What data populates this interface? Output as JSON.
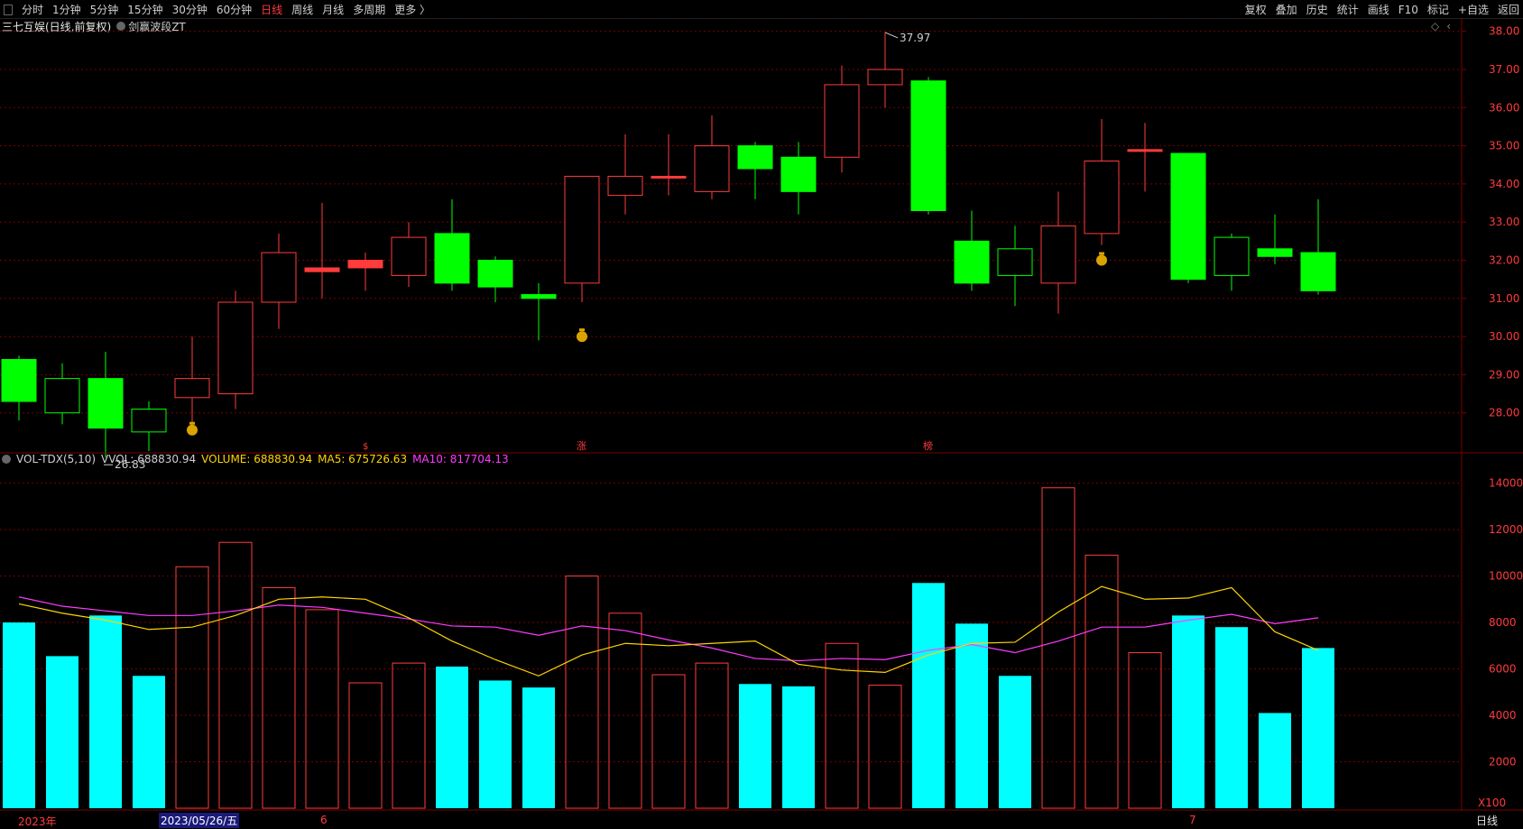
{
  "toolbar": {
    "periods": [
      "分时",
      "1分钟",
      "5分钟",
      "15分钟",
      "30分钟",
      "60分钟",
      "日线",
      "周线",
      "月线",
      "多周期",
      "更多 〉"
    ],
    "active_period": "日线",
    "right_items": [
      "复权",
      "叠加",
      "历史",
      "统计",
      "画线",
      "F10",
      "标记",
      "+自选",
      "返回"
    ]
  },
  "header": {
    "stock_title": "三七互娱(日线,前复权)",
    "indicator_name": "剑赢波段ZT"
  },
  "volume_legend": {
    "name": "VOL-TDX(5,10)",
    "vvol": "VVOL: 688830.94",
    "volume": "VOLUME: 688830.94",
    "ma5": "MA5: 675726.63",
    "ma10": "MA10: 817704.13",
    "unit": "X100"
  },
  "annotations": {
    "high_label": "37.97",
    "low_label": "26.83",
    "marker_1": "$",
    "marker_2": "涨",
    "marker_3": "榜"
  },
  "x_axis": {
    "year": "2023年",
    "selected_date": "2023/05/26/五",
    "month_6": "6",
    "month_7": "7"
  },
  "period_button": "日线",
  "colors": {
    "up": "#ff3b3b",
    "down_fill": "#00ff00",
    "vol_down": "#00ffff",
    "ma5": "#ffd400",
    "ma10": "#ff3bff",
    "grid": "#7a0000",
    "axis_text": "#ff3b3b"
  },
  "chart_data": [
    {
      "type": "candlestick",
      "title": "三七互娱(日线,前复权)",
      "ylim": [
        27.0,
        38.3
      ],
      "yticks": [
        28.0,
        29.0,
        30.0,
        31.0,
        32.0,
        33.0,
        34.0,
        35.0,
        36.0,
        37.0,
        38.0
      ],
      "candles": [
        {
          "o": 29.4,
          "h": 29.5,
          "l": 27.8,
          "c": 28.3
        },
        {
          "o": 28.9,
          "h": 29.3,
          "l": 27.7,
          "c": 28.0
        },
        {
          "o": 28.9,
          "h": 29.6,
          "l": 26.83,
          "c": 27.6
        },
        {
          "o": 28.1,
          "h": 28.3,
          "l": 27.0,
          "c": 27.5
        },
        {
          "o": 28.4,
          "h": 30.0,
          "l": 27.5,
          "c": 28.9
        },
        {
          "o": 28.5,
          "h": 31.2,
          "l": 28.1,
          "c": 30.9
        },
        {
          "o": 30.9,
          "h": 32.7,
          "l": 30.2,
          "c": 32.2
        },
        {
          "o": 31.7,
          "h": 33.5,
          "l": 31.0,
          "c": 31.8
        },
        {
          "o": 31.8,
          "h": 32.2,
          "l": 31.2,
          "c": 32.0
        },
        {
          "o": 31.6,
          "h": 33.0,
          "l": 31.3,
          "c": 32.6
        },
        {
          "o": 32.7,
          "h": 33.6,
          "l": 31.2,
          "c": 31.4
        },
        {
          "o": 32.0,
          "h": 32.1,
          "l": 30.9,
          "c": 31.3
        },
        {
          "o": 31.1,
          "h": 31.4,
          "l": 29.9,
          "c": 31.0
        },
        {
          "o": 31.4,
          "h": 34.2,
          "l": 30.9,
          "c": 34.2
        },
        {
          "o": 33.7,
          "h": 35.3,
          "l": 33.2,
          "c": 34.2
        },
        {
          "o": 34.2,
          "h": 35.3,
          "l": 33.7,
          "c": 34.2
        },
        {
          "o": 33.8,
          "h": 35.8,
          "l": 33.6,
          "c": 35.0
        },
        {
          "o": 35.0,
          "h": 35.1,
          "l": 33.6,
          "c": 34.4
        },
        {
          "o": 34.7,
          "h": 35.1,
          "l": 33.2,
          "c": 33.8
        },
        {
          "o": 34.7,
          "h": 37.1,
          "l": 34.3,
          "c": 36.6
        },
        {
          "o": 36.6,
          "h": 37.97,
          "l": 36.0,
          "c": 37.0
        },
        {
          "o": 36.7,
          "h": 36.8,
          "l": 33.2,
          "c": 33.3
        },
        {
          "o": 32.5,
          "h": 33.3,
          "l": 31.2,
          "c": 31.4
        },
        {
          "o": 32.3,
          "h": 32.9,
          "l": 30.8,
          "c": 31.6
        },
        {
          "o": 31.4,
          "h": 33.8,
          "l": 30.6,
          "c": 32.9
        },
        {
          "o": 32.7,
          "h": 35.7,
          "l": 32.4,
          "c": 34.6
        },
        {
          "o": 34.9,
          "h": 35.6,
          "l": 33.8,
          "c": 34.9
        },
        {
          "o": 34.8,
          "h": 34.8,
          "l": 31.4,
          "c": 31.5
        },
        {
          "o": 32.6,
          "h": 32.7,
          "l": 31.2,
          "c": 31.6
        },
        {
          "o": 32.3,
          "h": 33.2,
          "l": 31.9,
          "c": 32.1
        },
        {
          "o": 32.2,
          "h": 33.6,
          "l": 31.1,
          "c": 31.2
        }
      ]
    },
    {
      "type": "bar",
      "title": "VOL-TDX(5,10)",
      "ylim": [
        0,
        14800
      ],
      "yticks": [
        2000,
        4000,
        6000,
        8000,
        10000,
        12000,
        14000
      ],
      "volumes": [
        8000,
        6550,
        8300,
        5700,
        10400,
        11450,
        9500,
        8550,
        5400,
        6250,
        6100,
        5500,
        5200,
        10000,
        8400,
        5750,
        6250,
        5350,
        5250,
        7100,
        5300,
        9700,
        7950,
        5700,
        13800,
        10900,
        6700,
        8300,
        7800,
        4100,
        6900
      ],
      "ma5": [
        8800,
        8400,
        8100,
        7700,
        7800,
        8300,
        9000,
        9100,
        9000,
        8200,
        7200,
        6400,
        5700,
        6600,
        7100,
        7000,
        7100,
        7200,
        6200,
        5950,
        5850,
        6600,
        7100,
        7150,
        8450,
        9550,
        9000,
        9050,
        9500,
        7600,
        6800
      ],
      "ma10": [
        9100,
        8700,
        8500,
        8300,
        8300,
        8500,
        8750,
        8650,
        8400,
        8150,
        7850,
        7800,
        7450,
        7850,
        7650,
        7250,
        6900,
        6450,
        6350,
        6450,
        6400,
        6800,
        7050,
        6700,
        7200,
        7800,
        7800,
        8100,
        8350,
        7950,
        8200
      ]
    }
  ]
}
